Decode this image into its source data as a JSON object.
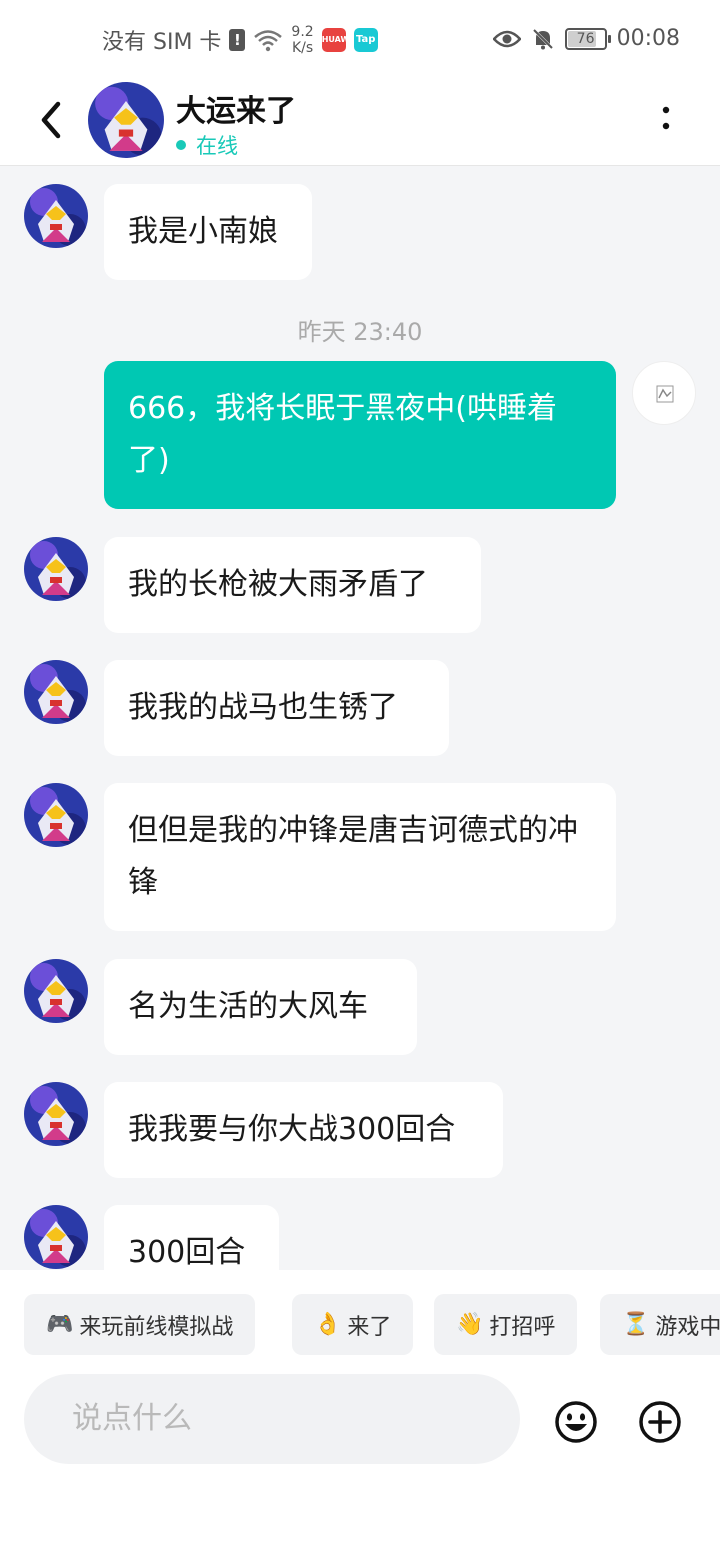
{
  "status_bar": {
    "carrier": "没有 SIM 卡",
    "net_speed_value": "9.2",
    "net_speed_unit": "K/s",
    "battery": "76",
    "time": "00:08",
    "app_badge_1": "HUAWEI",
    "app_badge_2": "Tap"
  },
  "header": {
    "name": "大运来了",
    "status": "在线"
  },
  "messages": [
    {
      "text": "我是小南娘"
    },
    {
      "timestamp": "昨天  23:40"
    },
    {
      "text": "666，我将长眠于黑夜中(哄睡着了)"
    },
    {
      "text": "我的长枪被大雨矛盾了"
    },
    {
      "text": "我我的战马也生锈了"
    },
    {
      "text": "但但是我的冲锋是唐吉诃德式的冲锋"
    },
    {
      "text": "名为生活的大风车"
    },
    {
      "text": "我我要与你大战300回合"
    },
    {
      "text": "300回合"
    }
  ],
  "quick_replies": [
    {
      "emoji": "🎮",
      "label": "来玩前线模拟战"
    },
    {
      "emoji": "👌",
      "label": "来了"
    },
    {
      "emoji": "👋",
      "label": "打招呼"
    },
    {
      "emoji": "⏳",
      "label": "游戏中"
    }
  ],
  "input": {
    "placeholder": "说点什么"
  },
  "colors": {
    "accent": "#00c8b3",
    "online": "#19c9b8",
    "background": "#f4f5f7"
  }
}
